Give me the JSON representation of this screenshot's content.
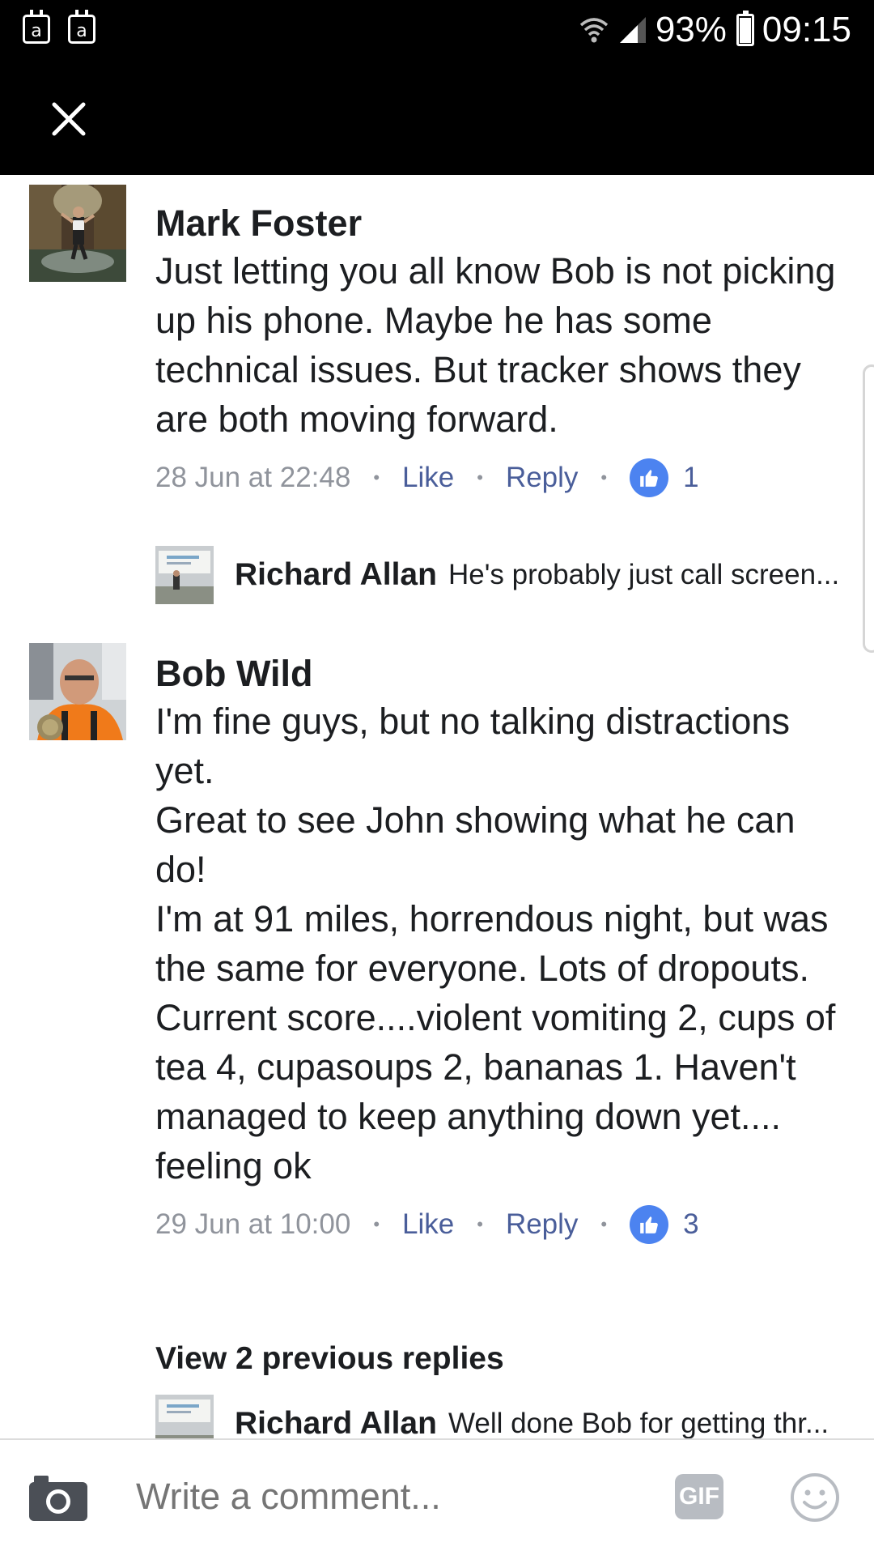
{
  "status_bar": {
    "notif_icon_1": "a",
    "notif_icon_2": "a",
    "battery_percent": "93%",
    "battery_level": 0.93,
    "time": "09:15"
  },
  "top_bar": {
    "close_icon": "close-icon"
  },
  "comments": [
    {
      "author": "Mark Foster",
      "text": "Just letting you all know Bob is not picking up his phone. Maybe he has some technical issues. But tracker shows they are both moving forward.",
      "timestamp": "28 Jun at 22:48",
      "like_label": "Like",
      "reply_label": "Reply",
      "like_count": "1",
      "reply_preview": {
        "author": "Richard Allan",
        "text": "He's probably just call screen..."
      }
    },
    {
      "author": "Bob Wild",
      "text": "I'm fine guys, but no talking distractions yet.\nGreat to see John showing what he can do!\nI'm at 91 miles, horrendous night, but was the same for everyone. Lots of dropouts.\nCurrent score....violent vomiting 2, cups of tea 4, cupasoups 2, bananas 1. Haven't managed to keep anything down yet.... feeling ok",
      "timestamp": "29 Jun at 10:00",
      "like_label": "Like",
      "reply_label": "Reply",
      "like_count": "3",
      "view_previous": "View 2 previous replies",
      "reply_preview": {
        "author": "Richard Allan",
        "text": "Well done Bob for getting thr..."
      }
    }
  ],
  "composer": {
    "placeholder": "Write a comment...",
    "gif_label": "GIF"
  },
  "colors": {
    "like_blue": "#4c83f0",
    "action_text": "#4a5e9a",
    "meta_grey": "#90949c"
  }
}
